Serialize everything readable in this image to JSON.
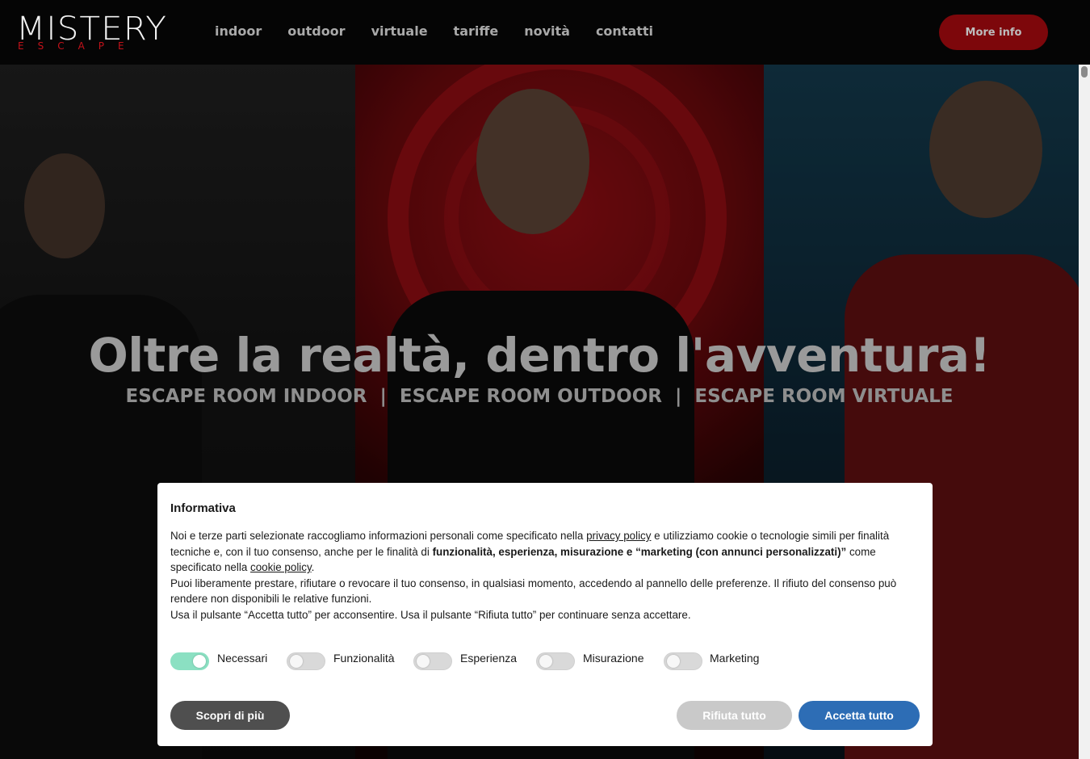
{
  "header": {
    "logo_main": "MISTERY",
    "logo_sub": "ESCAPE",
    "nav": [
      "indoor",
      "outdoor",
      "virtuale",
      "tariffe",
      "novità",
      "contatti"
    ],
    "cta_label": "More info"
  },
  "hero": {
    "title": "Oltre la realtà, dentro l'avventura!",
    "subtitle": "ESCAPE ROOM INDOOR  |  ESCAPE ROOM OUTDOOR  |  ESCAPE ROOM VIRTUALE"
  },
  "cookie": {
    "title": "Informativa",
    "p1_a": "Noi e terze parti selezionate raccogliamo informazioni personali come specificato nella ",
    "privacy_link": "privacy policy",
    "p1_b": " e utilizziamo cookie o tecnologie simili per finalità tecniche e, con il tuo consenso, anche per le finalità di ",
    "p1_bold": "funzionalità, esperienza, misurazione e “marketing (con annunci personalizzati)”",
    "p1_c": " come specificato nella ",
    "cookie_link": "cookie policy",
    "p1_d": ".",
    "p2": "Puoi liberamente prestare, rifiutare o revocare il tuo consenso, in qualsiasi momento, accedendo al pannello delle preferenze. Il rifiuto del consenso può rendere non disponibili le relative funzioni.",
    "p3": "Usa il pulsante “Accetta tutto” per acconsentire. Usa il pulsante “Rifiuta tutto” per continuare senza accettare.",
    "toggles": [
      {
        "label": "Necessari",
        "on": true
      },
      {
        "label": "Funzionalità",
        "on": false
      },
      {
        "label": "Esperienza",
        "on": false
      },
      {
        "label": "Misurazione",
        "on": false
      },
      {
        "label": "Marketing",
        "on": false
      }
    ],
    "btn_more": "Scopri di più",
    "btn_reject": "Rifiuta tutto",
    "btn_accept": "Accetta tutto"
  },
  "colors": {
    "accent_red": "#7d070b",
    "toggle_on": "#8be0c2",
    "accept_blue": "#2d6db5"
  }
}
